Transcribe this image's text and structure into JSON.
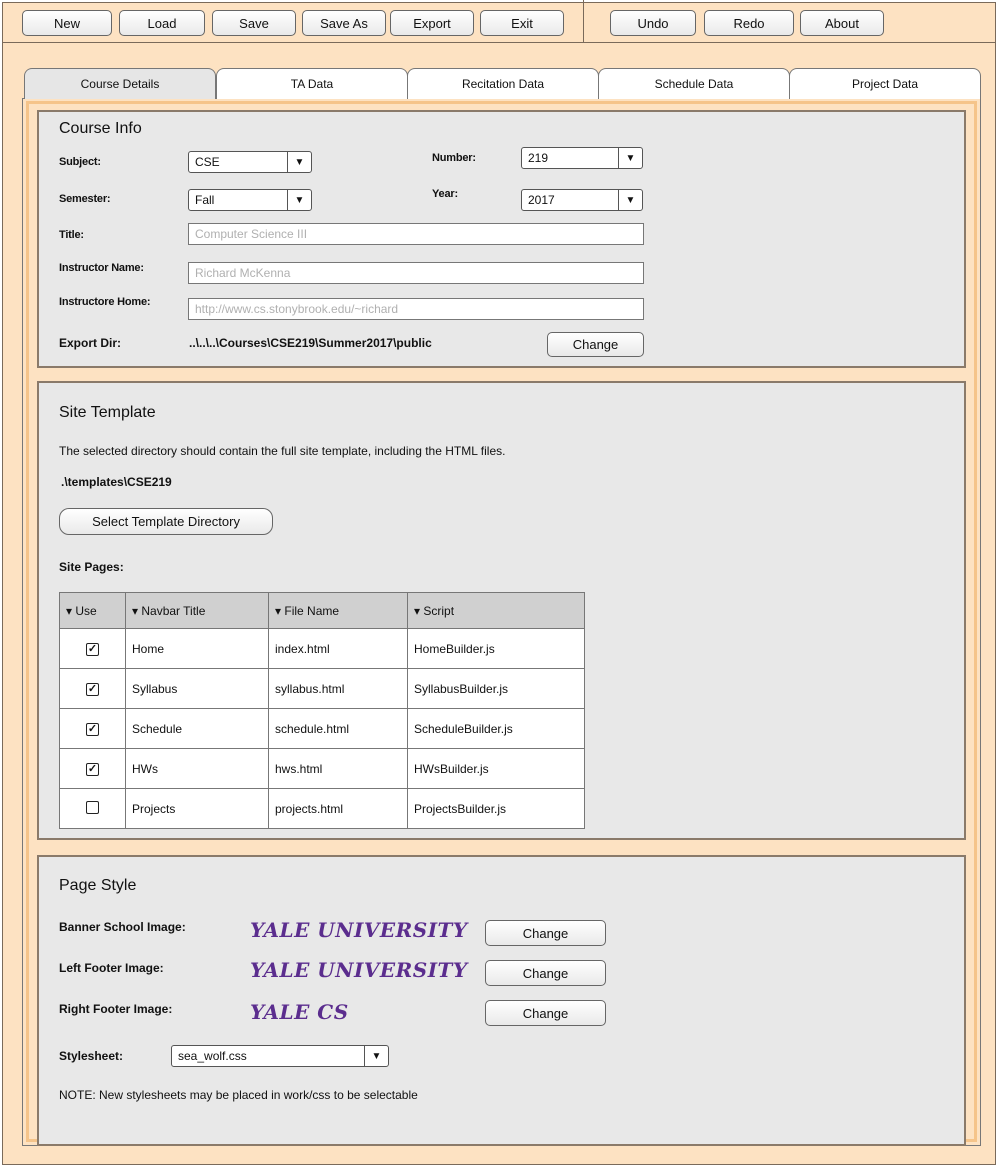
{
  "toolbar": {
    "new": "New",
    "load": "Load",
    "save": "Save",
    "save_as": "Save As",
    "export": "Export",
    "exit": "Exit",
    "undo": "Undo",
    "redo": "Redo",
    "about": "About"
  },
  "tabs": [
    "Course Details",
    "TA Data",
    "Recitation Data",
    "Schedule Data",
    "Project Data"
  ],
  "course_info": {
    "title": "Course Info",
    "subject_label": "Subject:",
    "subject_value": "CSE",
    "number_label": "Number:",
    "number_value": "219",
    "semester_label": "Semester:",
    "semester_value": "Fall",
    "year_label": "Year:",
    "year_value": "2017",
    "title_label": "Title:",
    "title_value": "Computer Science III",
    "instructor_name_label": "Instructor Name:",
    "instructor_name_value": "Richard McKenna",
    "instructor_home_label": "Instructore Home:",
    "instructor_home_value": "http://www.cs.stonybrook.edu/~richard",
    "export_dir_label": "Export Dir:",
    "export_dir_value": "..\\..\\..\\Courses\\CSE219\\Summer2017\\public",
    "change_label": "Change"
  },
  "site_template": {
    "title": "Site Template",
    "description": "The selected directory should contain the full site template, including the HTML files.",
    "path": ".\\templates\\CSE219",
    "select_button": "Select Template Directory",
    "pages_label": "Site Pages:",
    "columns": [
      "▾ Use",
      "▾ Navbar Title",
      "▾ File Name",
      "▾ Script"
    ],
    "rows": [
      {
        "use": true,
        "title": "Home",
        "file": "index.html",
        "script": "HomeBuilder.js"
      },
      {
        "use": true,
        "title": "Syllabus",
        "file": "syllabus.html",
        "script": "SyllabusBuilder.js"
      },
      {
        "use": true,
        "title": "Schedule",
        "file": "schedule.html",
        "script": "ScheduleBuilder.js"
      },
      {
        "use": true,
        "title": "HWs",
        "file": "hws.html",
        "script": "HWsBuilder.js"
      },
      {
        "use": false,
        "title": "Projects",
        "file": "projects.html",
        "script": "ProjectsBuilder.js"
      }
    ]
  },
  "page_style": {
    "title": "Page Style",
    "banner_label": "Banner School Image:",
    "banner_image_text": "YALE UNIVERSITY",
    "left_footer_label": "Left Footer Image:",
    "left_footer_image_text": "YALE UNIVERSITY",
    "right_footer_label": "Right Footer Image:",
    "right_footer_image_text": "YALE CS",
    "change_label": "Change",
    "stylesheet_label": "Stylesheet:",
    "stylesheet_value": "sea_wolf.css",
    "note": "NOTE: New stylesheets may be placed in work/css to be selectable"
  },
  "icons": {
    "dropdown": "dropdown-arrow-icon",
    "check": "checkbox-icon"
  },
  "colors": {
    "frame": "#fde2c2",
    "panel": "#e8e8e8",
    "yale": "#5b2d8e"
  }
}
